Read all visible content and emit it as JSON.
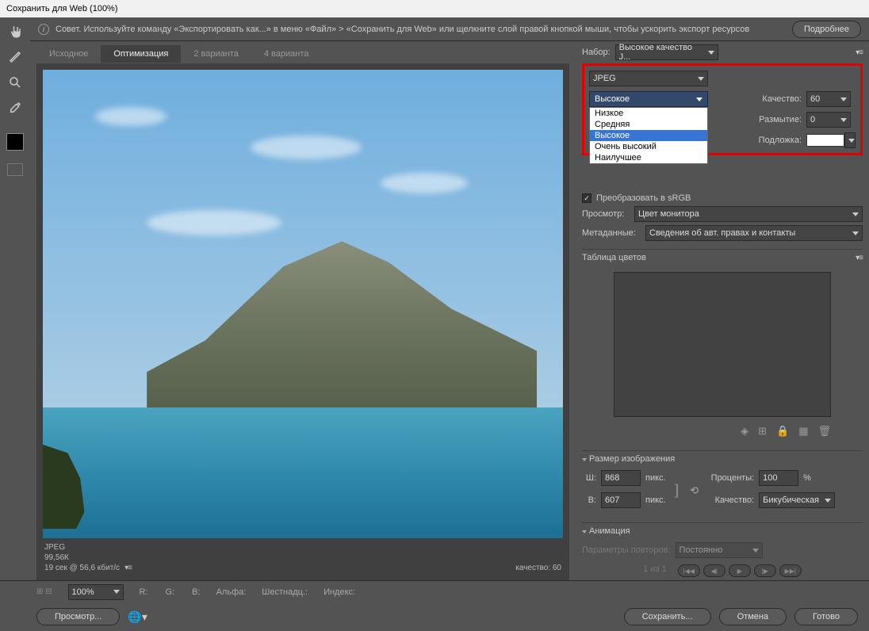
{
  "title": "Сохранить для Web (100%)",
  "tip": "Совет. Используйте команду «Экспортировать как...» в меню «Файл» > «Сохранить для Web» или щелкните слой правой кнопкой мыши, чтобы ускорить экспорт ресурсов",
  "more_btn": "Подробнее",
  "tabs": [
    "Исходное",
    "Оптимизация",
    "2 варианта",
    "4 варианта"
  ],
  "active_tab": 1,
  "status": {
    "format": "JPEG",
    "size": "99,56К",
    "time": "19 сек @ 56,6 кбит/с",
    "quality": "качество: 60"
  },
  "preset": {
    "label": "Набор:",
    "value": "Высокое качество J..."
  },
  "format_select": "JPEG",
  "quality_select": {
    "selected": "Высокое",
    "options": [
      "Низкое",
      "Средняя",
      "Высокое",
      "Очень высокий",
      "Наилучшее"
    ]
  },
  "quality": {
    "label": "Качество:",
    "value": "60"
  },
  "blur": {
    "label": "Размытие:",
    "value": "0"
  },
  "matte": {
    "label": "Подложка:"
  },
  "srgb": {
    "label": "Преобразовать в sRGB"
  },
  "preview": {
    "label": "Просмотр:",
    "value": "Цвет монитора"
  },
  "metadata": {
    "label": "Метаданные:",
    "value": "Сведения об авт. правах и контакты"
  },
  "colortable": {
    "title": "Таблица цветов"
  },
  "imagesize": {
    "title": "Размер изображения",
    "w": {
      "label": "Ш:",
      "value": "868",
      "unit": "пикс."
    },
    "h": {
      "label": "В:",
      "value": "607",
      "unit": "пикс."
    },
    "percent": {
      "label": "Проценты:",
      "value": "100",
      "unit": "%"
    },
    "quality": {
      "label": "Качество:",
      "value": "Бикубическая"
    }
  },
  "animation": {
    "title": "Анимация",
    "repeat_label": "Параметры повторов:",
    "repeat_value": "Постоянно",
    "frame": "1 из 1"
  },
  "bottombar": {
    "zoom": "100%",
    "channels": {
      "r": "R:",
      "g": "G:",
      "b": "B:",
      "alpha": "Альфа:",
      "hex": "Шестнадц.:",
      "index": "Индекс:"
    }
  },
  "footer": {
    "preview": "Просмотр...",
    "save": "Сохранить...",
    "cancel": "Отмена",
    "done": "Готово"
  }
}
